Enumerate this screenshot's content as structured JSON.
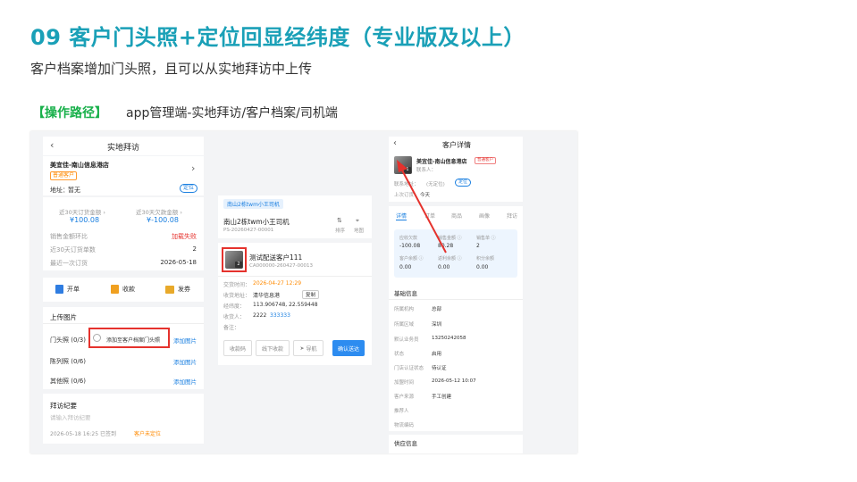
{
  "page": {
    "title": "09  客户门头照+定位回显经纬度（专业版及以上）",
    "subtitle": "客户档案增加门头照，且可以从实地拜访中上传",
    "path_label": "【操作路径】",
    "path_text": "app管理端-实地拜访/客户档案/司机端"
  },
  "visit": {
    "back": "‹",
    "header": "实地拜访",
    "customer_name": "美宜佳-南山信息港店",
    "customer_tag": "普通客户",
    "chevron": "›",
    "address_label": "地址：",
    "address_value": "暂无",
    "locate": "定位",
    "stat1_label": "近30天订货金额 ›",
    "stat1_value": "¥100.08",
    "stat2_label": "近30天欠款金额 ›",
    "stat2_value": "¥-100.08",
    "rows": [
      {
        "label": "销售金额环比",
        "value": "加载失败"
      },
      {
        "label": "近30天订货单数",
        "value": "2"
      },
      {
        "label": "最近一次订货",
        "value": "2026-05-18"
      }
    ],
    "actions": [
      {
        "icon": "order-icon",
        "label": "开单"
      },
      {
        "icon": "receipt-icon",
        "label": "收款"
      },
      {
        "icon": "coupon-icon",
        "label": "发券"
      }
    ],
    "upload_title": "上传图片",
    "storefront_label": "门头照 (0/3)",
    "storefront_option": "添加至客户档案门头照",
    "add_image": "添加图片",
    "display_label": "陈列照 (0/6)",
    "other_label": "其他照 (0/6)",
    "summary_title": "拜访纪要",
    "summary_placeholder": "请输入拜访纪要",
    "signin_time": "2026-05-18 16:25 已签到",
    "signin_status": "客户未定位"
  },
  "driver": {
    "tab_label": "南山2栋twm小王司机",
    "driver_name": "南山2栋twm小王司机",
    "driver_code": "PS-20260427-00001",
    "sort_label": "排序",
    "map_label": "地图",
    "customer_name": "测试配送客户111",
    "order_code": "CA000000-260427-00013",
    "thumb_count": "2",
    "fields": [
      {
        "label": "交货时间：",
        "value": "2026-04-27 12:29"
      },
      {
        "label": "收货地址：",
        "value": "清华信息港"
      },
      {
        "label": "经纬度：",
        "value": "113.906748, 22.559448"
      },
      {
        "label": "收货人：",
        "value": "2222"
      },
      {
        "label": "备注：",
        "value": ""
      }
    ],
    "copy": "复制",
    "phone": "333333",
    "buttons": [
      "收款码",
      "线下收款",
      "导航",
      "确认送达"
    ]
  },
  "detail": {
    "back": "‹",
    "header": "客户详情",
    "customer_name": "美宜佳-南山信息港店",
    "customer_tag": "普通客户",
    "contact_label": "联系人：",
    "contact_value": "",
    "address_label": "联系地址：",
    "address_value": "(无定位)",
    "locate": "定位",
    "last_order_label": "上次订货：",
    "last_order_value": "今天",
    "thumb_count": "1",
    "tabs": [
      "详情",
      "订单",
      "商品",
      "画像",
      "拜访"
    ],
    "metrics": [
      {
        "label": "应收欠款",
        "value": "-100.08"
      },
      {
        "label": "销售金额 ⓘ",
        "value": "80.28"
      },
      {
        "label": "销售单 ⓘ",
        "value": "2"
      },
      {
        "label": "客户余额 ⓘ",
        "value": "0.00"
      },
      {
        "label": "返利余额 ⓘ",
        "value": "0.00"
      },
      {
        "label": "积分余额",
        "value": "0.00"
      }
    ],
    "basic_title": "基础信息",
    "info": [
      {
        "label": "所属机构",
        "value": "总部"
      },
      {
        "label": "所属区域",
        "value": "深圳"
      },
      {
        "label": "默认业务员",
        "value": "13250242058"
      },
      {
        "label": "状态",
        "value": "启用"
      },
      {
        "label": "门店认证状态",
        "value": "待认证"
      },
      {
        "label": "加盟时间",
        "value": "2026-05-12 10:07"
      },
      {
        "label": "客户来源",
        "value": "手工创建"
      },
      {
        "label": "推荐人",
        "value": ""
      },
      {
        "label": "物流编码",
        "value": ""
      }
    ],
    "supplier_title": "供应信息"
  },
  "colors": {
    "accent": "#1aa0b7",
    "path_green": "#18b04a",
    "link_blue": "#1a7fe0",
    "alert_red": "#e5322d",
    "orange": "#ff8a00"
  }
}
